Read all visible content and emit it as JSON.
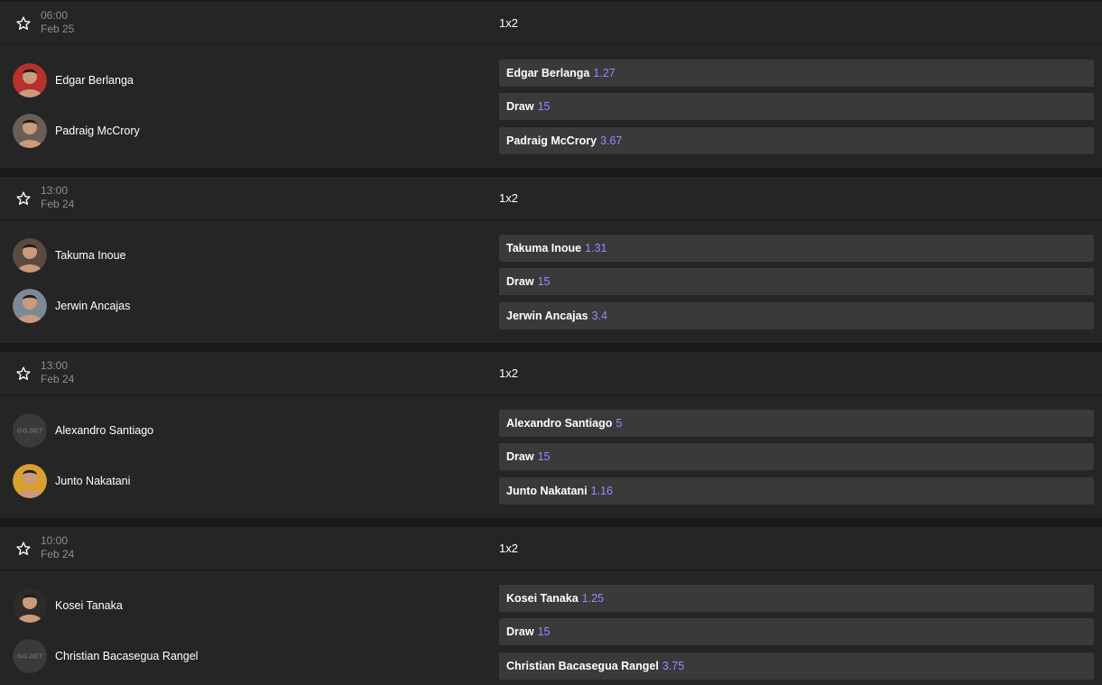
{
  "colors": {
    "page_background": "#1a1a1a",
    "card_background": "#252525",
    "odd_background": "#3a3a3a",
    "odd_value": "#9d86ff",
    "muted_text": "#8e8e8e"
  },
  "icons": {
    "favorite": "star-outline-icon",
    "placeholder_avatar": "ggbet-logo"
  },
  "placeholder_logo_text": "GG.BET",
  "matches": [
    {
      "time": "06:00",
      "date": "Feb 25",
      "market": "1x2",
      "competitors": [
        {
          "name": "Edgar Berlanga",
          "avatar": "photo",
          "avatar_color": "#b5322e"
        },
        {
          "name": "Padraig McCrory",
          "avatar": "photo",
          "avatar_color": "#6a5d55"
        }
      ],
      "odds": [
        {
          "label": "Edgar Berlanga",
          "value": "1.27"
        },
        {
          "label": "Draw",
          "value": "15"
        },
        {
          "label": "Padraig McCrory",
          "value": "3.67"
        }
      ]
    },
    {
      "time": "13:00",
      "date": "Feb 24",
      "market": "1x2",
      "competitors": [
        {
          "name": "Takuma Inoue",
          "avatar": "photo",
          "avatar_color": "#5b4a40"
        },
        {
          "name": "Jerwin Ancajas",
          "avatar": "photo",
          "avatar_color": "#7c8a96"
        }
      ],
      "odds": [
        {
          "label": "Takuma Inoue",
          "value": "1.31"
        },
        {
          "label": "Draw",
          "value": "15"
        },
        {
          "label": "Jerwin Ancajas",
          "value": "3.4"
        }
      ]
    },
    {
      "time": "13:00",
      "date": "Feb 24",
      "market": "1x2",
      "competitors": [
        {
          "name": "Alexandro Santiago",
          "avatar": "placeholder",
          "avatar_color": "#3a3a3a"
        },
        {
          "name": "Junto Nakatani",
          "avatar": "photo",
          "avatar_color": "#d9a030"
        }
      ],
      "odds": [
        {
          "label": "Alexandro Santiago",
          "value": "5"
        },
        {
          "label": "Draw",
          "value": "15"
        },
        {
          "label": "Junto Nakatani",
          "value": "1.16"
        }
      ]
    },
    {
      "time": "10:00",
      "date": "Feb 24",
      "market": "1x2",
      "competitors": [
        {
          "name": "Kosei Tanaka",
          "avatar": "photo",
          "avatar_color": "#2e2a28"
        },
        {
          "name": "Christian Bacasegua Rangel",
          "avatar": "placeholder",
          "avatar_color": "#3a3a3a"
        }
      ],
      "odds": [
        {
          "label": "Kosei Tanaka",
          "value": "1.25"
        },
        {
          "label": "Draw",
          "value": "15"
        },
        {
          "label": "Christian Bacasegua Rangel",
          "value": "3.75"
        }
      ]
    }
  ]
}
